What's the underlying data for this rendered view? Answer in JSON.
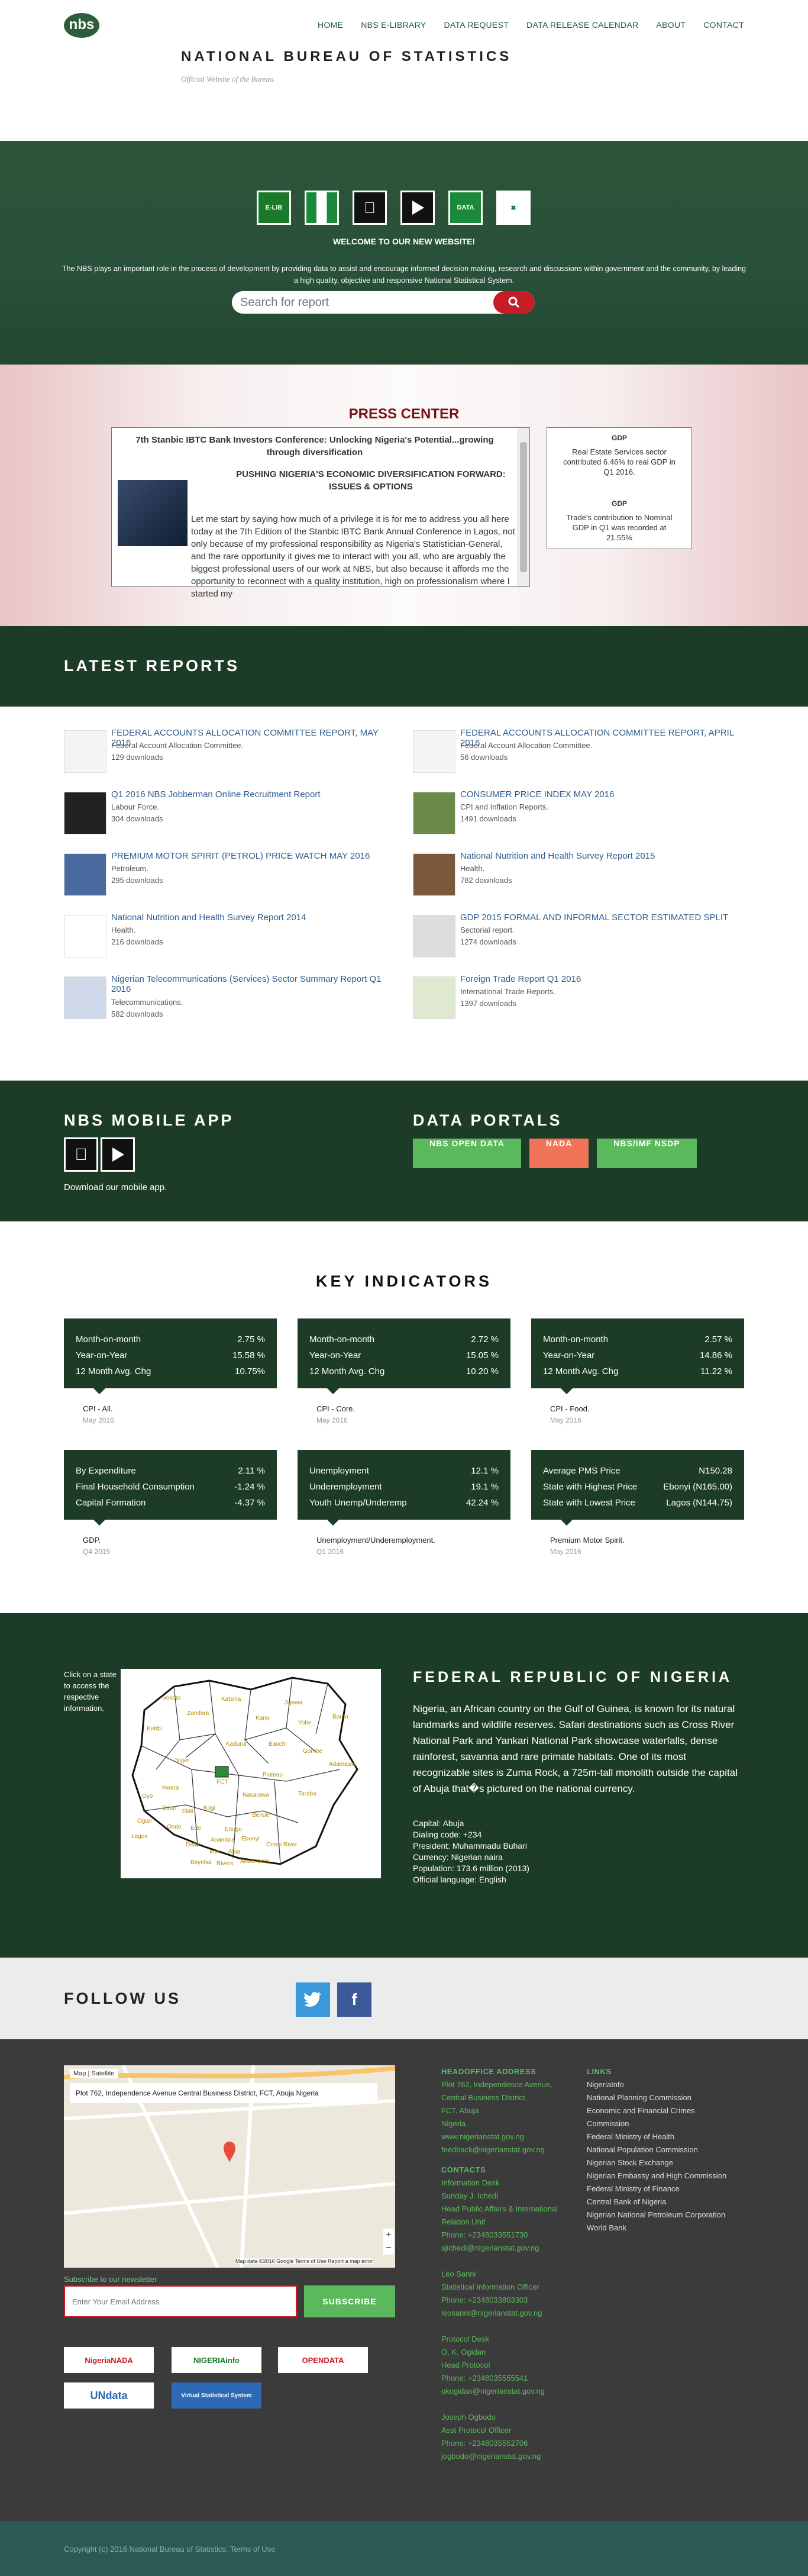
{
  "header": {
    "logo_text": "nbs",
    "nav": [
      "HOME",
      "NBS E-LIBRARY",
      "DATA REQUEST",
      "DATA RELEASE CALENDAR",
      "ABOUT",
      "CONTACT"
    ],
    "site_title": "NATIONAL BUREAU OF STATISTICS",
    "site_subtitle": "Official Website of the Bureau."
  },
  "hero": {
    "app_icons": [
      "e-library-icon",
      "nigeria-flag-icon",
      "apple-icon",
      "google-play-icon",
      "nigeria-data-icon",
      "nbs-icon"
    ],
    "welcome": "WELCOME TO OUR NEW WEBSITE!",
    "text": "The NBS plays an important role in the process of development by providing data to assist and encourage informed decision making, research and discussions within government and the community, by leading a high quality, objective and responsive National Statistical System.",
    "search_placeholder": "Search for report"
  },
  "press": {
    "title": "PRESS CENTER",
    "headline": "7th Stanbic IBTC Bank Investors Conference: Unlocking Nigeria's Potential...growing through diversification",
    "subhead": "PUSHING NIGERIA'S ECONOMIC DIVERSIFICATION FORWARD: ISSUES & OPTIONS",
    "paragraph": "Let me start by saying how much of a privilege it is for me to address you all here today at the 7th Edition of the Stanbic IBTC Bank Annual Conference in Lagos, not only because of my professional responsibility as Nigeria's Statistician-General, and the rare opportunity it gives me to interact with you all, who are arguably the biggest professional users of our work at NBS, but also because it affords me the opportunity to reconnect with a quality institution, high on professionalism where I started my",
    "gdp_items": [
      {
        "title": "GDP",
        "text": "Real Estate Services sector contributed 6.46% to real GDP in Q1 2016."
      },
      {
        "title": "GDP",
        "text": "Trade's contribution to Nominal GDP in Q1 was recorded at 21.55%"
      }
    ]
  },
  "reports": {
    "title": "LATEST REPORTS",
    "items": [
      {
        "title": "FEDERAL ACCOUNTS ALLOCATION COMMITTEE REPORT, MAY 2016",
        "category": "Federal Account Allocation Committee.",
        "downloads": "129 downloads"
      },
      {
        "title": "FEDERAL ACCOUNTS ALLOCATION COMMITTEE REPORT, APRIL 2016",
        "category": "Federal Account Allocation Committee.",
        "downloads": "56 downloads"
      },
      {
        "title": "Q1 2016 NBS Jobberman Online Recruitment Report",
        "category": "Labour Force.",
        "downloads": "304 downloads"
      },
      {
        "title": "CONSUMER PRICE INDEX MAY 2016",
        "category": "CPI and Inflation Reports.",
        "downloads": "1491 downloads"
      },
      {
        "title": "PREMIUM MOTOR SPIRIT (PETROL) PRICE WATCH MAY 2016",
        "category": "Petroleum.",
        "downloads": "295 downloads"
      },
      {
        "title": "National Nutrition and Health Survey Report 2015",
        "category": "Health.",
        "downloads": "782 downloads"
      },
      {
        "title": "National Nutrition and Health Survey Report 2014",
        "category": "Health.",
        "downloads": "216 downloads"
      },
      {
        "title": "GDP 2015 FORMAL AND INFORMAL SECTOR ESTIMATED SPLIT",
        "category": "Sectorial report.",
        "downloads": "1274 downloads"
      },
      {
        "title": "Nigerian Telecommunications (Services) Sector Summary Report Q1 2016",
        "category": "Telecommunications.",
        "downloads": "582 downloads"
      },
      {
        "title": "Foreign Trade Report Q1 2016",
        "category": "International Trade Reports.",
        "downloads": "1397 downloads"
      }
    ]
  },
  "mobile": {
    "title": "NBS MOBILE APP",
    "text": "Download our mobile app."
  },
  "portals": {
    "title": "DATA PORTALS",
    "buttons": [
      {
        "label": "NBS OPEN DATA",
        "color": "#5cb85c"
      },
      {
        "label": "NADA",
        "color": "#f0735a"
      },
      {
        "label": "NBS/IMF NSDP",
        "color": "#5cb85c"
      }
    ]
  },
  "indicators": {
    "title": "KEY INDICATORS",
    "cards": [
      {
        "rows": [
          [
            "Month-on-month",
            "2.75 %"
          ],
          [
            "Year-on-Year",
            "15.58 %"
          ],
          [
            "12 Month Avg. Chg",
            "10.75%"
          ]
        ],
        "label": "CPI - All.",
        "date": "May 2016"
      },
      {
        "rows": [
          [
            "Month-on-month",
            "2.72 %"
          ],
          [
            "Year-on-Year",
            "15.05 %"
          ],
          [
            "12 Month Avg. Chg",
            "10.20 %"
          ]
        ],
        "label": "CPI - Core.",
        "date": "May 2016"
      },
      {
        "rows": [
          [
            "Month-on-month",
            "2.57 %"
          ],
          [
            "Year-on-Year",
            "14.86 %"
          ],
          [
            "12 Month Avg. Chg",
            "11.22 %"
          ]
        ],
        "label": "CPI - Food.",
        "date": "May 2016"
      },
      {
        "rows": [
          [
            "By Expenditure",
            "2.11 %"
          ],
          [
            "Final Household Consumption",
            "-1.24 %"
          ],
          [
            "Capital Formation",
            "-4.37 %"
          ]
        ],
        "label": "GDP.",
        "date": "Q4 2015"
      },
      {
        "rows": [
          [
            "Unemployment",
            "12.1 %"
          ],
          [
            "Underemployment",
            "19.1 %"
          ],
          [
            "Youth Unemp/Underemp",
            "42.24 %"
          ]
        ],
        "label": "Unemployment/Underemployment.",
        "date": "Q1 2016"
      },
      {
        "rows": [
          [
            "Average PMS Price",
            "N150.28"
          ],
          [
            "State with Highest Price",
            "Ebonyi (N165.00)"
          ],
          [
            "State with Lowest Price",
            "Lagos (N144.75)"
          ]
        ],
        "label": "Premium Motor Spirit.",
        "date": "May 2016"
      }
    ]
  },
  "federal": {
    "map_note": "Click on a state to access the respective information.",
    "title": "FEDERAL REPUBLIC OF NIGERIA",
    "paragraph": "Nigeria, an African country on the Gulf of Guinea, is known for its natural landmarks and wildlife reserves. Safari destinations such as Cross River National Park and Yankari National Park showcase waterfalls, dense rainforest, savanna and rare primate habitats. One of its most recognizable sites is Zuma Rock, a 725m-tall monolith outside the capital of Abuja that�s pictured on the national currency.",
    "facts": [
      "Capital: Abuja",
      "Dialing code: +234",
      "President: Muhammadu Buhari",
      "Currency: Nigerian naira",
      "Population: 173.6 million (2013)",
      "Official language: English"
    ],
    "states": [
      "Sokoto",
      "Kebbi",
      "Zamfara",
      "Katsina",
      "Kano",
      "Jigawa",
      "Yobe",
      "Borno",
      "Kaduna",
      "Bauchi",
      "Gombe",
      "Adamawa",
      "Niger",
      "FCT",
      "Plateau",
      "Taraba",
      "Kwara",
      "Nasarawa",
      "Oyo",
      "Osun",
      "Ekiti",
      "Kogi",
      "Benue",
      "Ogun",
      "Ondo",
      "Edo",
      "Enugu",
      "Lagos",
      "Delta",
      "Anambra",
      "Ebonyi",
      "Cross River",
      "Imo",
      "Abia",
      "Bayelsa",
      "Rivers",
      "Akwa Ibom"
    ]
  },
  "follow": {
    "title": "FOLLOW US",
    "twitter_icon": "twitter-icon",
    "facebook_icon": "facebook-icon"
  },
  "footer": {
    "map_address": "Plot 762, Independence Avenue Central Business District, FCT, Abuja Nigeria",
    "map_tab_map": "Map",
    "map_tab_sat": "Satellite",
    "map_footer": "Map data ©2016 Google   Terms of Use   Report a map error",
    "newsletter_label": "Subscribe to our newsletter",
    "newsletter_placeholder": "Enter Your Email Address",
    "subscribe": "SUBSCRIBE",
    "partners": [
      "NigeriaNADA",
      "NIGERIAinfo",
      "OPENDATA",
      "UNdata",
      "Virtual Statistical System"
    ],
    "hq_title": "HEADOFFICE ADDRESS",
    "hq_lines": [
      "Plot 762, Independence Avenue,",
      "Central Business District,",
      "FCT, Abuja",
      "Nigeria.",
      "www.nigerianstat.gov.ng",
      "feedback@nigerianstat.gov.ng"
    ],
    "contacts_title": "CONTACTS",
    "contact_lines": [
      "Information Desk",
      "Sunday J. Ichedi",
      "Head Public Affairs & International",
      "Relation Unit",
      "Phone: +2348033551730",
      "sjichedi@nigerianstat.gov.ng",
      "",
      "Leo Sanni",
      "Statistical Information Officer",
      "Phone: +2348033803303",
      "leosanni@nigerianstat.gov.ng",
      "",
      "Protocol Desk",
      "O. K. Ogidan",
      "Head Protocol",
      "Phone: +2348035555541",
      "okogidan@nigerianstat.gov.ng",
      "",
      "Joseph Ogbodo",
      "Asst Protocol Officer",
      "Phone: +2348035552706",
      "jogbodo@nigerianstat.gov.ng"
    ],
    "links_title": "LINKS",
    "links": [
      "NigeriaInfo",
      "National Planning Commission",
      "Economic and Financial Crimes",
      "Commission",
      "Federal Ministry of Health",
      "National Population Commission",
      "Nigerian Stock Exchange",
      "Nigerian Embassy and High Commission",
      "Federal Ministry of Finance",
      "Central Bank of Nigeria",
      "Nigerian National Petroleum Corporation",
      "World Bank"
    ],
    "copyright": "Copyright (c) 2016 National Bureau of Statistics.   Terms of Use"
  }
}
